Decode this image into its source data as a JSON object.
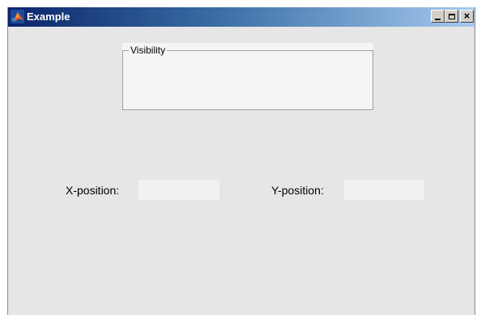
{
  "window": {
    "title": "Example",
    "icon": "matlab-icon",
    "controls": [
      "minimize-icon",
      "maximize-icon",
      "close-icon"
    ]
  },
  "panel": {
    "title": "Visibility"
  },
  "fields": {
    "x_label": "X-position:",
    "x_value": "",
    "y_label": "Y-position:",
    "y_value": ""
  },
  "colors": {
    "background": "#e6e6e6",
    "titlebar_start": "#0a246a",
    "titlebar_end": "#a6caf0",
    "field_bg": "#f1f1f1"
  }
}
